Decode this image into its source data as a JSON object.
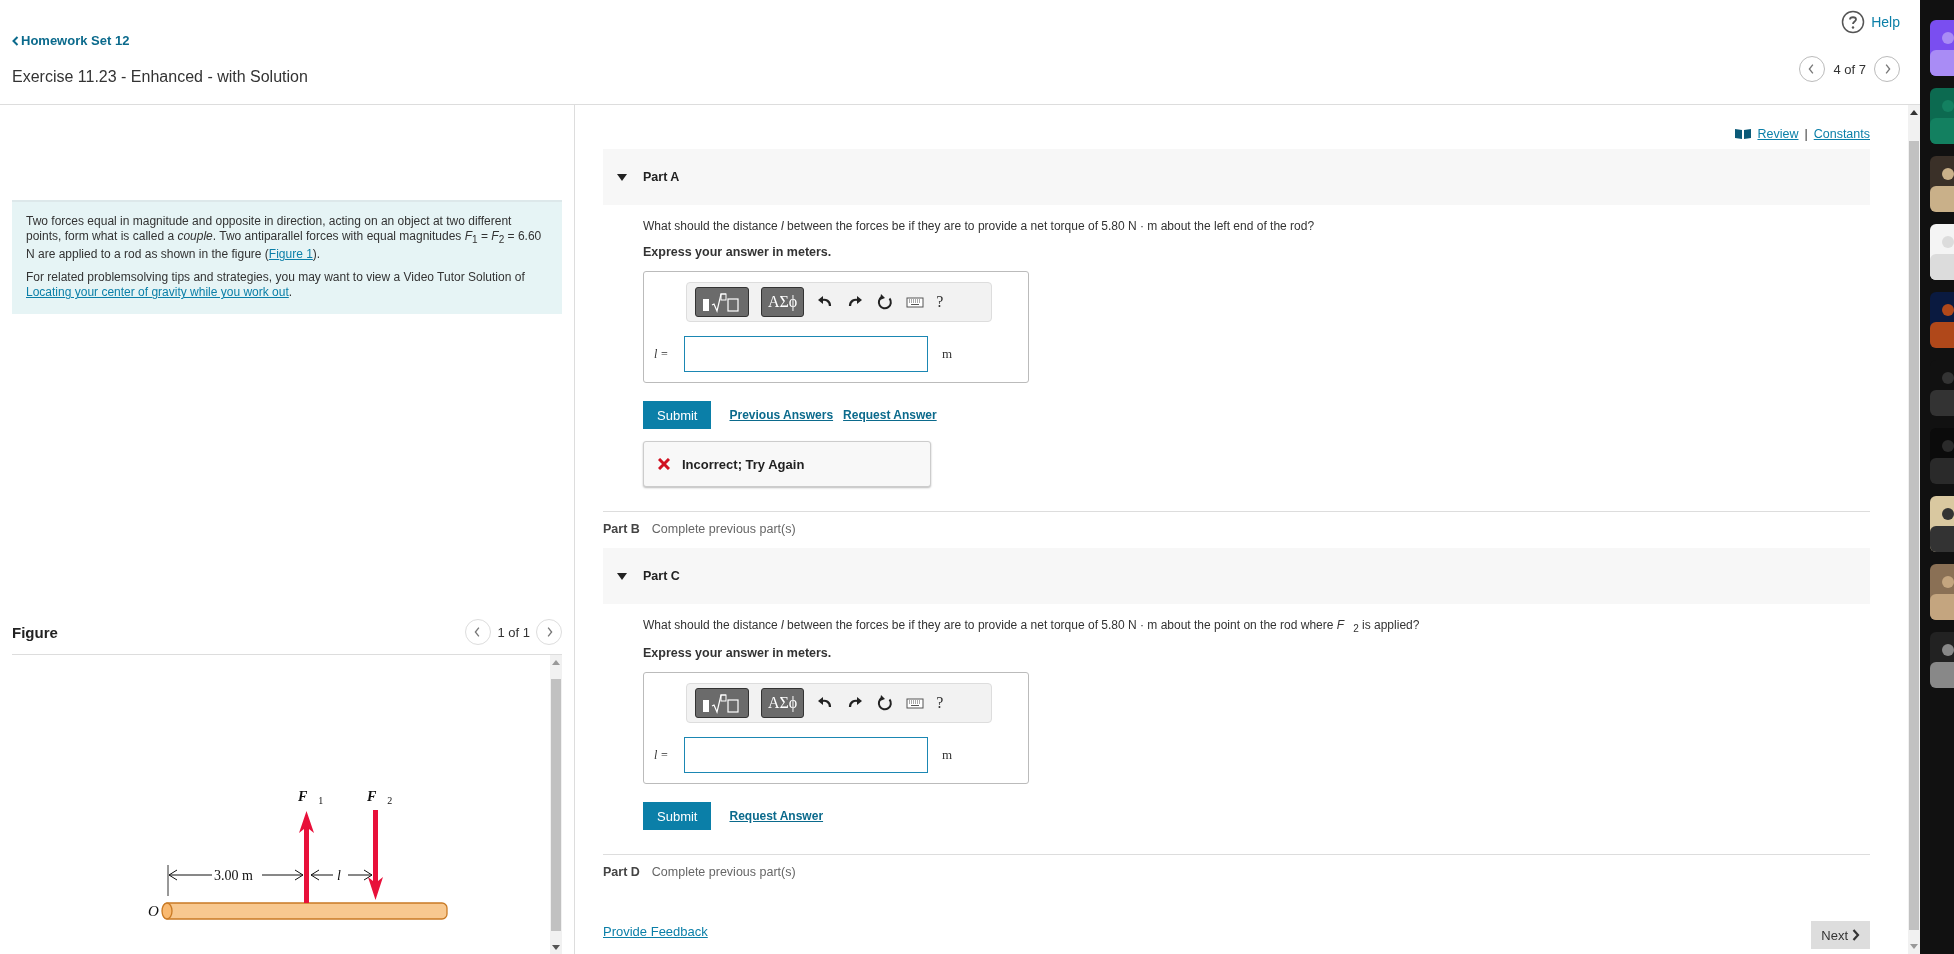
{
  "header": {
    "back_link": "Homework Set 12",
    "title": "Exercise 11.23 - Enhanced - with Solution",
    "help": "Help",
    "pager": "4 of 7"
  },
  "problem": {
    "paragraphs": [
      [
        {
          "text": "Two forces equal in magnitude and opposite in direction, acting on an object at two different points, form what is called a *couple*. Two antiparallel forces with equal magnitudes *F*$_{1}$ = *F*$_{2}$ = 6.60 N are applied to a rod as shown in the figure ("
        },
        {
          "link": "Figure 1"
        },
        {
          "text": ")."
        }
      ],
      [
        {
          "text": "For related problemsolving tips and strategies, you may want to view a Video Tutor Solution of "
        },
        {
          "link": "Locating your center of gravity while you work out"
        },
        {
          "text": "."
        }
      ]
    ]
  },
  "figure": {
    "title": "Figure",
    "pager": "1 of 1",
    "force_1": {
      "symbol": "F⃗",
      "subscript": "1"
    },
    "force_2": {
      "symbol": "F⃗",
      "subscript": "2"
    },
    "distance": "3.00 m",
    "gap": "l",
    "origin": "O"
  },
  "resources": {
    "review": "Review",
    "separator": "|",
    "constants": "Constants"
  },
  "parts": [
    {
      "kind": "open",
      "label": "Part A",
      "question": "What should the distance *l* between the forces be if they are to provide a net torque of 5.80 N · m about the left end of the rod?",
      "instruction": "Express your answer in meters.",
      "toolbar": {
        "symbols": "ΑΣϕ",
        "help": "?"
      },
      "variable": "l =",
      "unit": "m",
      "submit": "Submit",
      "links": [
        "Previous Answers",
        "Request Answer"
      ],
      "feedback": {
        "kind": "incorrect",
        "text": "Incorrect; Try Again"
      }
    },
    {
      "kind": "locked",
      "label": "Part B",
      "status": "Complete previous part(s)"
    },
    {
      "kind": "open",
      "label": "Part C",
      "question": "What should the distance *l* between the forces be if they are to provide a net torque of 5.80 N · m about the point on the rod where *F⃗*$_{2}$ is applied?",
      "instruction": "Express your answer in meters.",
      "toolbar": {
        "symbols": "ΑΣϕ",
        "help": "?"
      },
      "variable": "l =",
      "unit": "m",
      "submit": "Submit",
      "links": [
        "Request Answer"
      ]
    },
    {
      "kind": "locked",
      "label": "Part D",
      "status": "Complete previous part(s)"
    }
  ],
  "footer": {
    "feedback_link": "Provide Feedback",
    "next": "Next"
  }
}
